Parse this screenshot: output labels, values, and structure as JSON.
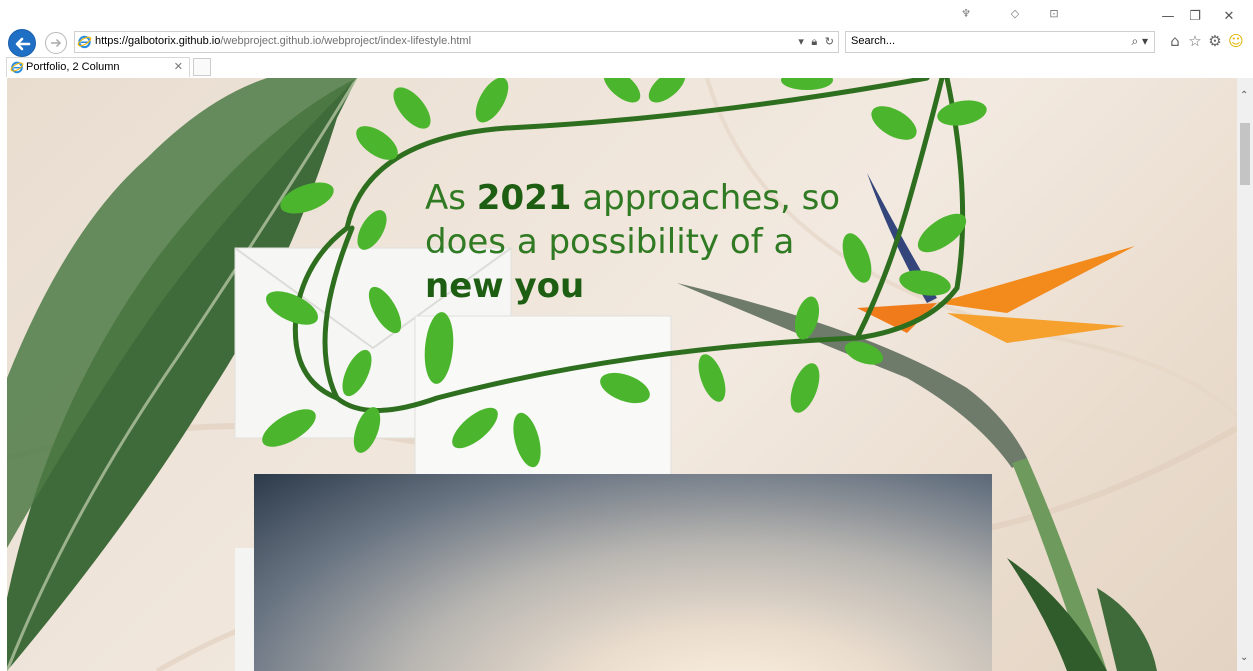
{
  "browser": {
    "url_host": "https://galbotorix.github.io",
    "url_path": "/webproject.github.io/webproject/index-lifestyle.html",
    "search_placeholder": "Search...",
    "tab_title": "Portfolio, 2 Column",
    "addr_icons": [
      "dropdown-icon",
      "lock-icon",
      "refresh-icon"
    ],
    "toolbar_icons": [
      "home-icon",
      "favorites-star-icon",
      "settings-gear-icon",
      "feedback-smiley-icon"
    ],
    "accent": "#1f6fc5"
  },
  "page": {
    "headline": {
      "part1": "As ",
      "year": "2021",
      "part2": " approaches, so does a possibility of a ",
      "bold1": "new",
      "bold2": "you"
    },
    "colors": {
      "headline_green": "#2f7a22",
      "headline_bold_green": "#1e5e12",
      "leaf_green": "#4cb52e",
      "vine_green": "#2e6e1f",
      "flower_orange": "#f08a1e"
    }
  }
}
